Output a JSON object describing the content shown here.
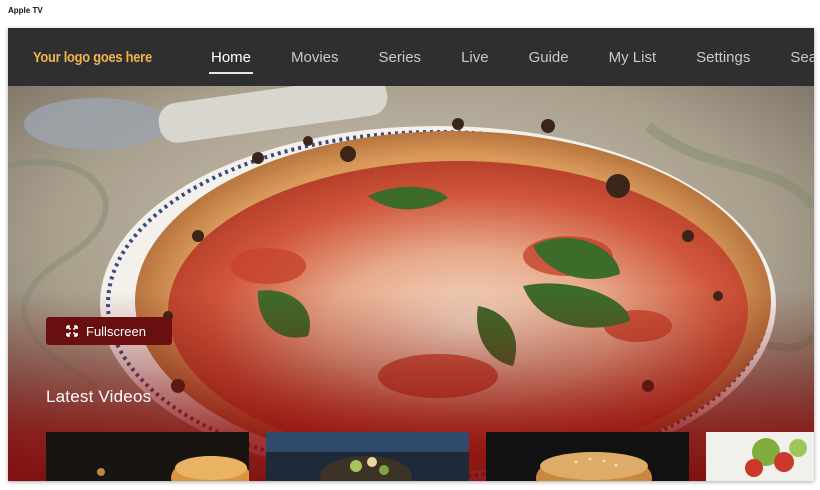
{
  "device_label": "Apple TV",
  "app": {
    "logo_text": "Your logo goes here"
  },
  "nav": {
    "items": [
      {
        "label": "Home",
        "active": true
      },
      {
        "label": "Movies",
        "active": false
      },
      {
        "label": "Series",
        "active": false
      },
      {
        "label": "Live",
        "active": false
      },
      {
        "label": "Guide",
        "active": false
      },
      {
        "label": "My List",
        "active": false
      },
      {
        "label": "Settings",
        "active": false
      },
      {
        "label": "Search",
        "active": false
      }
    ]
  },
  "hero": {
    "image_subject": "margherita pizza on marble table",
    "fullscreen_label": "Fullscreen",
    "fullscreen_icon": "expand-icon"
  },
  "section": {
    "title": "Latest Videos",
    "tiles": [
      {
        "subject": "burger-dark-background"
      },
      {
        "subject": "salad-bowl"
      },
      {
        "subject": "burger-sesame-bun"
      },
      {
        "subject": "salad-light"
      }
    ]
  },
  "colors": {
    "logo": "#f0b44a",
    "navbar_bg": "#2f2f2f",
    "button_bg": "#6a0f10",
    "overlay_red": "#8c0c0c"
  }
}
